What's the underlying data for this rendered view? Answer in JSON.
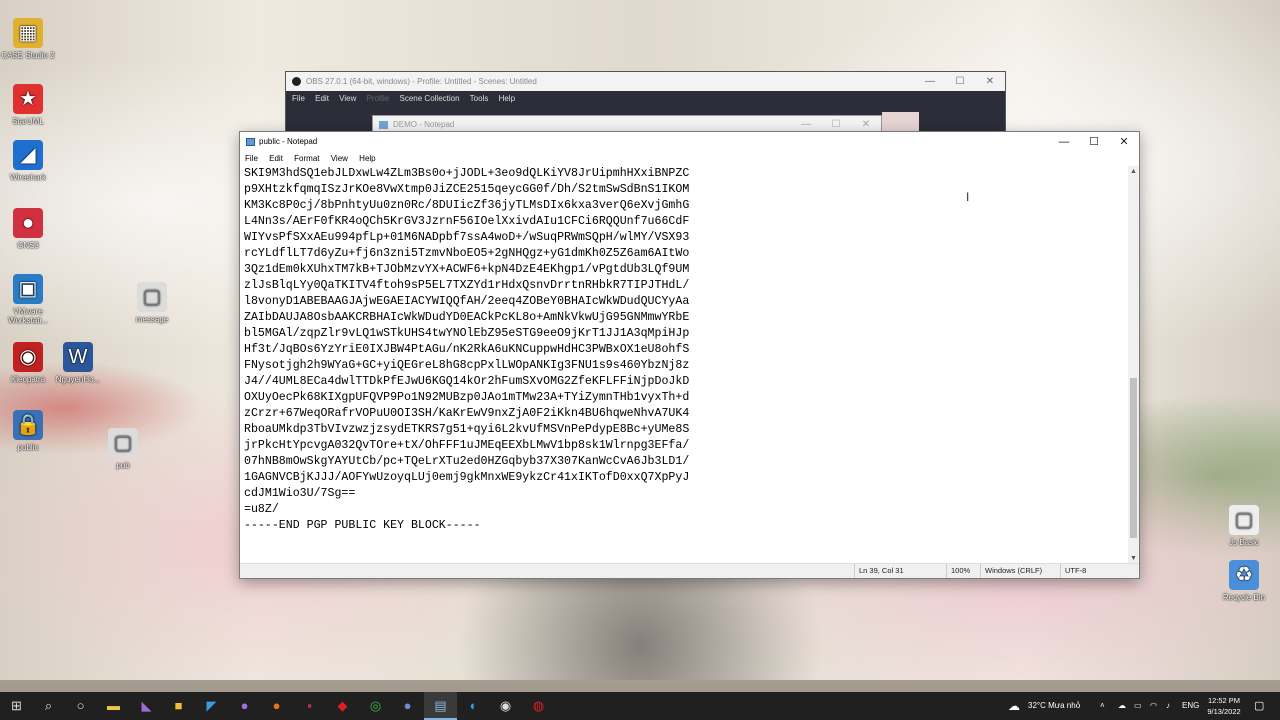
{
  "desktop": {
    "icons": [
      {
        "label": "CASE Studio 2",
        "glyph": "▦",
        "color": "#e0b030"
      },
      {
        "label": "StarUML",
        "glyph": "★",
        "color": "#e03030"
      },
      {
        "label": "Wireshark",
        "glyph": "◢",
        "color": "#1e6fd0"
      },
      {
        "label": "GNS3",
        "glyph": "●",
        "color": "#d03040"
      },
      {
        "label": "VMware Workstati...",
        "glyph": "▣",
        "color": "#2a7cc7"
      },
      {
        "label": "Kleopatra",
        "glyph": "◉",
        "color": "#c02020"
      },
      {
        "label": "public",
        "glyph": "🔒",
        "color": "#3b6fb6"
      },
      {
        "label": "message",
        "glyph": "▢",
        "color": "#dcdcdc"
      },
      {
        "label": "NguyenHo...",
        "glyph": "W",
        "color": "#2b579a"
      },
      {
        "label": "pub",
        "glyph": "▢",
        "color": "#dcdcdc"
      },
      {
        "label": "Js Basic",
        "glyph": "▢",
        "color": "#eeeeee"
      },
      {
        "label": "Recycle Bin",
        "glyph": "♻",
        "color": "#4a90d9"
      }
    ]
  },
  "obs": {
    "title": "OBS 27.0.1 (64-bit, windows) - Profile: Untitled - Scenes: Untitled",
    "menu": [
      "File",
      "Edit",
      "View",
      "Profile",
      "Scene Collection",
      "Tools",
      "Help"
    ]
  },
  "demo_window": {
    "title": "DEMO - Notepad"
  },
  "notepad": {
    "title": "public - Notepad",
    "menu": [
      "File",
      "Edit",
      "Format",
      "View",
      "Help"
    ],
    "lines": [
      "SKI9M3hdSQ1ebJLDxwLw4ZLm3Bs0o+jJODL+3eo9dQLKiYV8JrUipmhHXxiBNPZC",
      "p9XHtzkfqmqISzJrKOe8VwXtmp0JiZCE2515qeycGG0f/Dh/S2tmSwSdBnS1IKOM",
      "KM3Kc8P0cj/8bPnhtyUu0zn0Rc/8DUIicZf36jyTLMsDIx6kxa3verQ6eXvjGmhG",
      "L4Nn3s/AErF0fKR4oQCh5KrGV3JzrnF56IOelXxivdAIu1CFCi6RQQUnf7u66CdF",
      "WIYvsPfSXxAEu994pfLp+01M6NADpbf7ssA4woD+/wSuqPRWmSQpH/wlMY/VSX93",
      "rcYLdflLT7d6yZu+fj6n3zni5TzmvNboEO5+2gNHQgz+yG1dmKh0Z5Z6am6AItWo",
      "3Qz1dEm0kXUhxTM7kB+TJObMzvYX+ACWF6+kpN4DzE4EKhgp1/vPgtdUb3LQf9UM",
      "zlJsBlqLYy0QaTKITV4ftoh9sP5EL7TXZYd1rHdxQsnvDrrtnRHbkR7TIPJTHdL/",
      "l8vonyD1ABEBAAGJAjwEGAEIACYWIQQfAH/2eeq4ZOBeY0BHAIcWkWDudQUCYyAa",
      "ZAIbDAUJA8OsbAAKCRBHAIcWkWDudYD0EACkPcKL8o+AmNkVkwUjG95GNMmwYRbE",
      "bl5MGAl/zqpZlr9vLQ1wSTkUHS4twYNOlEbZ95eSTG9eeO9jKrT1JJ1A3qMpiHJp",
      "Hf3t/JqBOs6YzYriE0IXJBW4PtAGu/nK2RkA6uKNCuppwHdHC3PWBxOX1eU8ohfS",
      "FNysotjgh2h9WYaG+GC+yiQEGreL8hG8cpPxlLWOpANKIg3FNU1s9s460YbzNj8z",
      "J4//4UML8ECa4dwlTTDkPfEJwU6KGQ14kOr2hFumSXvOMG2ZfeKFLFFiNjpDoJkD",
      "OXUyOecPk68KIXgpUFQVP9Po1N92MUBzp0JAo1mTMw23A+TYiZymnTHb1vyxTh+d",
      "zCrzr+67WeqORafrVOPuU0OI3SH/KaKrEwV9nxZjA0F2iKkn4BU6hqweNhvA7UK4",
      "RboaUMkdp3TbVIvzwzjzsydETKRS7g51+qyi6L2kvUfMSVnPePdypE8Bc+yUMe8S",
      "jrPkcHtYpcvgA032QvTOre+tX/OhFFF1uJMEqEEXbLMwV1bp8sk1Wlrnpg3EFfa/",
      "07hNB8mOwSkgYAYUtCb/pc+TQeLrXTu2ed0HZGqbyb37X307KanWcCvA6Jb3LD1/",
      "1GAGNVCBjKJJJ/AOFYwUzoyqLUj0emj9gkMnxWE9ykzCr41xIKTofD0xxQ7XpPyJ",
      "cdJM1Wio3U/7Sg==",
      "=u8Z/",
      "-----END PGP PUBLIC KEY BLOCK-----"
    ],
    "status": {
      "position": "Ln 39, Col 31",
      "zoom": "100%",
      "line_ending": "Windows (CRLF)",
      "encoding": "UTF-8"
    }
  },
  "taskbar": {
    "weather": "32°C  Mưa nhỏ",
    "language": "ENG",
    "time": "12:52 PM",
    "date": "9/13/2022"
  }
}
